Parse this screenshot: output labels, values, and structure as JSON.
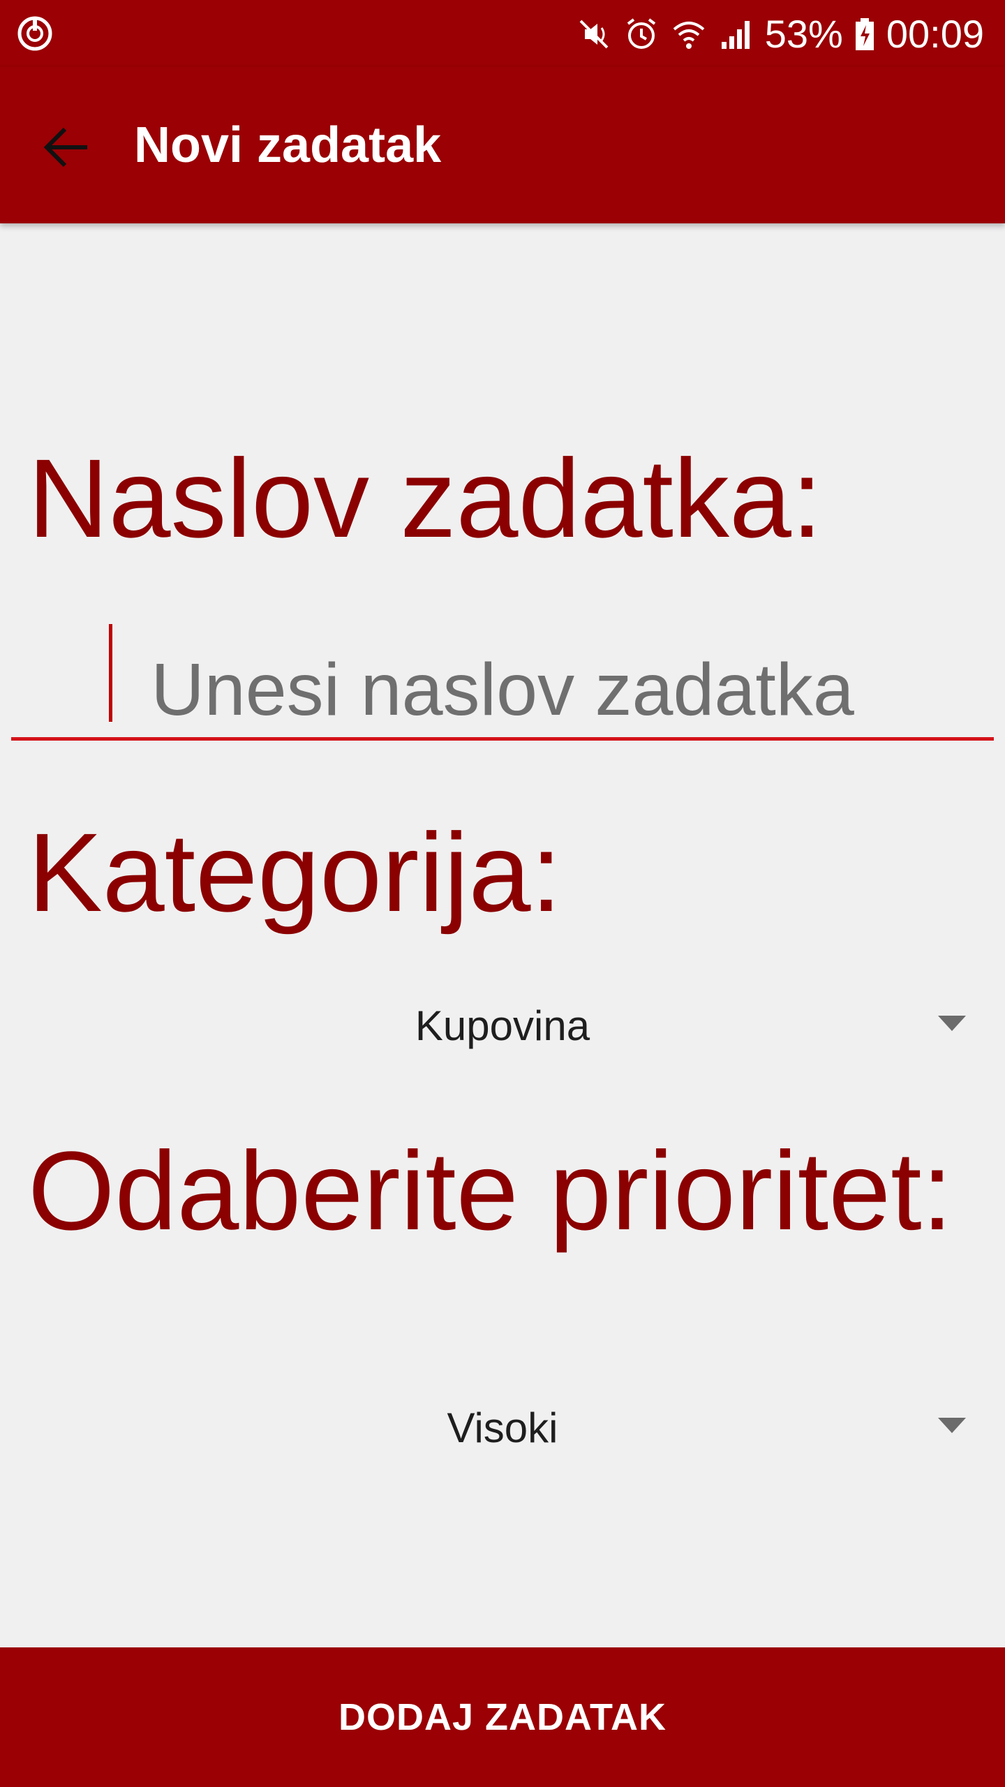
{
  "colors": {
    "primary": "#9a0004",
    "label": "#8b0000",
    "accent": "#d4141a",
    "background": "#f0f0f0"
  },
  "status_bar": {
    "icons_left": [
      "app-notification-icon"
    ],
    "icons_right": [
      "mute-icon",
      "alarm-icon",
      "wifi-icon",
      "signal-icon"
    ],
    "battery_percent": "53%",
    "battery_icon": "battery-charging-icon",
    "time": "00:09"
  },
  "toolbar": {
    "back_icon": "arrow-back-icon",
    "title": "Novi zadatak"
  },
  "form": {
    "title_label": "Naslov zadatka:",
    "title_input": {
      "value": "",
      "placeholder": "Unesi naslov zadatka"
    },
    "category_label": "Kategorija:",
    "category_selected": "Kupovina",
    "priority_label": "Odaberite prioritet:",
    "priority_selected": "Visoki"
  },
  "actions": {
    "add_label": "DODAJ ZADATAK"
  }
}
